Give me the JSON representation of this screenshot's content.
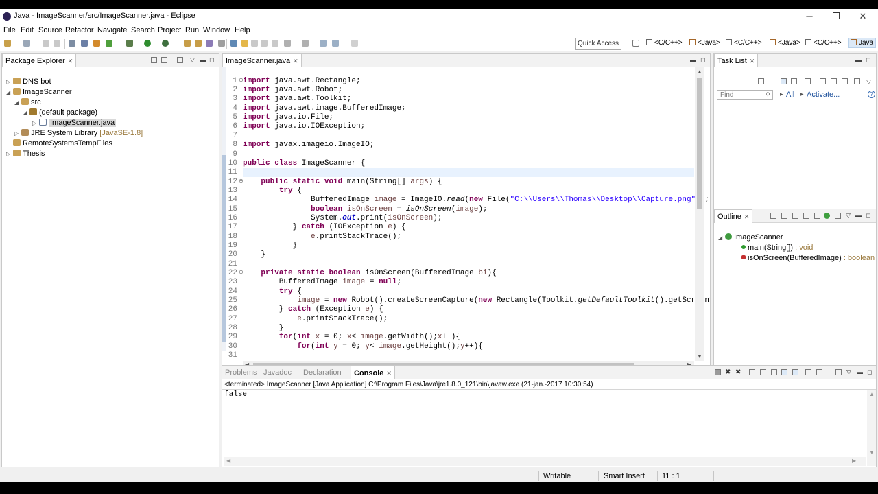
{
  "window": {
    "title": "Java - ImageScanner/src/ImageScanner.java - Eclipse",
    "controls": {
      "minimize": "─",
      "restore": "❐",
      "close": "✕"
    }
  },
  "menubar": [
    "File",
    "Edit",
    "Source",
    "Refactor",
    "Navigate",
    "Search",
    "Project",
    "Run",
    "Window",
    "Help"
  ],
  "toolbar": {
    "quick_access": "Quick Access",
    "perspectives": [
      "<C/C++>",
      "<Java>",
      "<C/C++>",
      "<Java>",
      "<C/C++>",
      "Java"
    ]
  },
  "package_explorer": {
    "tab_label": "Package Explorer",
    "items": [
      {
        "label": "DNS bot",
        "extra": ""
      },
      {
        "label": "ImageScanner",
        "extra": ""
      },
      {
        "label": "src",
        "extra": ""
      },
      {
        "label": "(default package)",
        "extra": ""
      },
      {
        "label": "ImageScanner.java",
        "extra": ""
      },
      {
        "label": "JRE System Library",
        "extra": "[JavaSE-1.8]"
      },
      {
        "label": "RemoteSystemsTempFiles",
        "extra": ""
      },
      {
        "label": "Thesis",
        "extra": ""
      }
    ]
  },
  "editor": {
    "tab_label": "ImageScanner.java",
    "line_numbers": [
      "1",
      "2",
      "3",
      "4",
      "5",
      "6",
      "7",
      "8",
      "9",
      "10",
      "11",
      "12",
      "13",
      "14",
      "15",
      "16",
      "17",
      "18",
      "19",
      "20",
      "21",
      "22",
      "23",
      "24",
      "25",
      "26",
      "27",
      "28",
      "29",
      "30",
      "31"
    ]
  },
  "task_list": {
    "tab_label": "Task List",
    "find_placeholder": "Find",
    "all": "All",
    "activate": "Activate..."
  },
  "outline": {
    "tab_label": "Outline",
    "root": "ImageScanner",
    "members": [
      {
        "name": "main(String[])",
        "type": ": void"
      },
      {
        "name": "isOnScreen(BufferedImage)",
        "type": ": boolean"
      }
    ]
  },
  "bottom_tabs": {
    "problems": "Problems",
    "javadoc": "Javadoc",
    "declaration": "Declaration",
    "console": "Console"
  },
  "console": {
    "header": "<terminated> ImageScanner [Java Application] C:\\Program Files\\Java\\jre1.8.0_121\\bin\\javaw.exe (21-jan.-2017 10:30:54)",
    "output": "false"
  },
  "statusbar": {
    "writable": "Writable",
    "insert_mode": "Smart Insert",
    "position": "11 : 1"
  },
  "colors": {
    "keyword": "#7f0055",
    "string": "#2a00ff",
    "variable": "#6a3e3e",
    "selection_tab": "#dce9f7"
  }
}
